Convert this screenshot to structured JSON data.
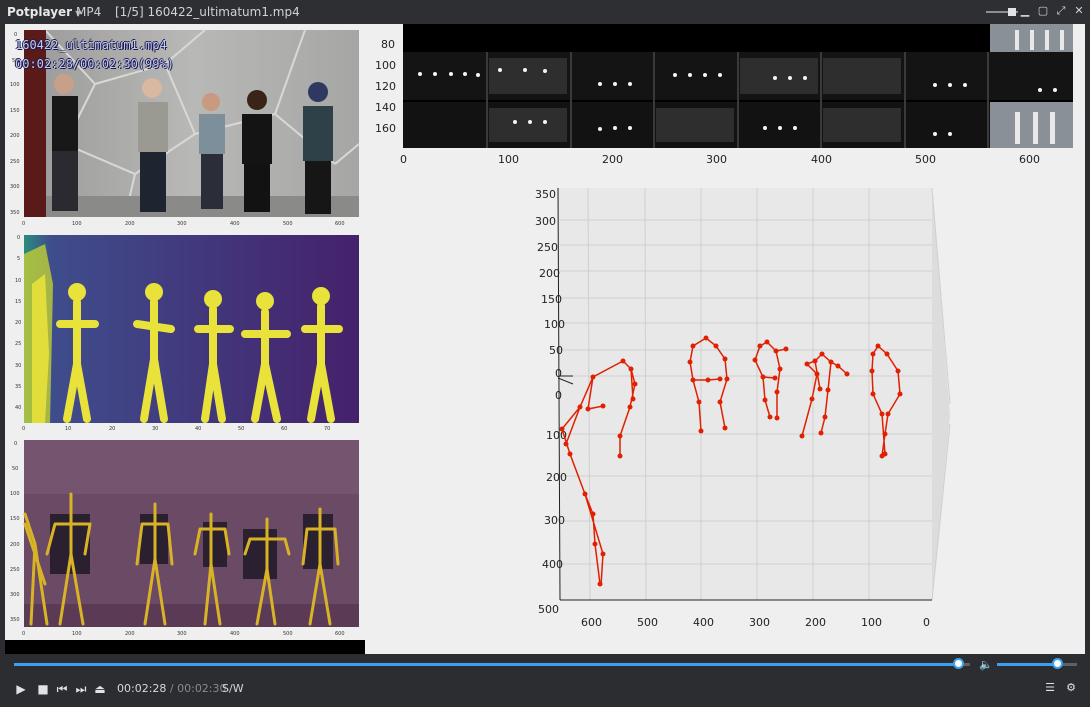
{
  "app": {
    "name": "Potplayer",
    "format": "MP4",
    "file_title": "[1/5] 160422_ultimatum1.mp4"
  },
  "overlay": {
    "filename": "160422_ultimatum1.mp4",
    "timecode": "00:02:28/00:02:30(99%)"
  },
  "playback": {
    "current": "00:02:28",
    "separator": " / ",
    "total": "00:02:30",
    "progress_fraction": 0.987,
    "volume_fraction": 0.75,
    "mode": "S/W"
  },
  "icons": [
    "play-icon",
    "stop-icon",
    "previous-icon",
    "next-icon",
    "eject-icon",
    "volume-icon",
    "playlist-icon",
    "settings-icon",
    "minimize-icon",
    "maximize-icon",
    "fullscreen-icon",
    "close-icon"
  ],
  "colors": {
    "accent": "#3aa0f0",
    "skeleton_3d": "#e02000",
    "skeleton_2d": "#d9b326"
  },
  "panels": {
    "rgb": {
      "x_ticks": [
        "0",
        "100",
        "200",
        "300",
        "400",
        "500",
        "600"
      ],
      "y_ticks": [
        "0",
        "50",
        "100",
        "150",
        "200",
        "250",
        "300",
        "350"
      ]
    },
    "heatmap": {
      "x_ticks": [
        "0",
        "10",
        "20",
        "30",
        "40",
        "50",
        "60",
        "70"
      ],
      "y_ticks": [
        "0",
        "5",
        "10",
        "15",
        "20",
        "25",
        "30",
        "35",
        "40"
      ]
    },
    "pose2d": {
      "x_ticks": [
        "0",
        "100",
        "200",
        "300",
        "400",
        "500",
        "600"
      ],
      "y_ticks": [
        "0",
        "50",
        "100",
        "150",
        "200",
        "250",
        "300",
        "350"
      ]
    },
    "strip": {
      "x_ticks": [
        "0",
        "100",
        "200",
        "300",
        "400",
        "500",
        "600"
      ],
      "y_ticks": [
        "80",
        "100",
        "120",
        "140",
        "160"
      ]
    },
    "plot3d": {
      "x_ticks": [
        "600",
        "500",
        "400",
        "300",
        "200",
        "100",
        "0"
      ],
      "y_ticks_upper": [
        "350",
        "300",
        "250",
        "200",
        "150",
        "100",
        "50",
        "0"
      ],
      "y_ticks_lower": [
        "0",
        "100",
        "200",
        "300",
        "400",
        "500"
      ]
    }
  }
}
